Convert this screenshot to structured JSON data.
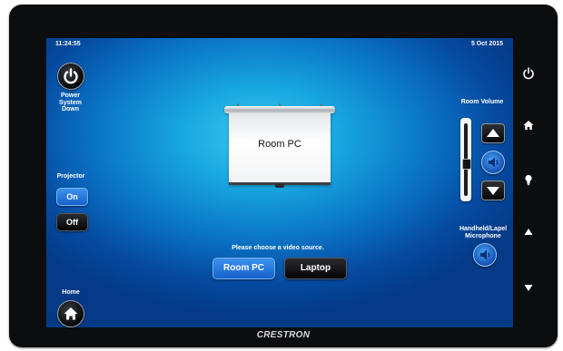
{
  "device": {
    "brand": "CRESTRON"
  },
  "status_bar": {
    "time": "11:24:55",
    "date": "5 Oct 2015"
  },
  "left_panel": {
    "power_label": "Power System Down",
    "projector_label": "Projector",
    "projector_on_label": "On",
    "projector_off_label": "Off",
    "projector_selected": "On",
    "home_label": "Home"
  },
  "screen_preview": {
    "label": "Room PC"
  },
  "source_selection": {
    "prompt": "Please choose a video source.",
    "sources": [
      "Room PC",
      "Laptop"
    ],
    "selected": "Room PC"
  },
  "volume": {
    "label": "Room Volume",
    "level": 0.45,
    "mic_label": "Handheld/Lapel Microphone"
  },
  "hard_buttons": [
    "power-icon",
    "home-icon",
    "lightbulb-icon",
    "arrow-up-icon",
    "arrow-down-icon"
  ],
  "colors": {
    "accent_selected": "#2a7be0",
    "button_dark": "#0a0a0b",
    "screen_blue": "#0a73c6"
  }
}
